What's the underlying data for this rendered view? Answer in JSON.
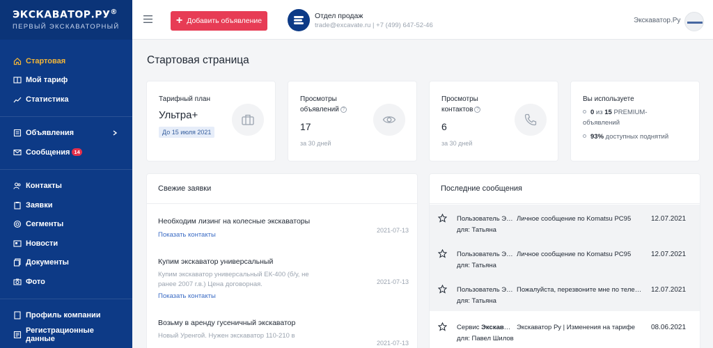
{
  "brand": {
    "logo_title": "ЭКСКАВАТОР.РУ",
    "logo_reg": "®",
    "logo_subtitle": "ПЕРВЫЙ ЭКСКАВАТОРНЫЙ",
    "accent": "#0d3a86",
    "active_color": "#f3b638",
    "button_color": "#e73c55"
  },
  "sidebar": {
    "group1": [
      {
        "label": "Стартовая",
        "icon": "home-icon",
        "active": true
      },
      {
        "label": "Мой тариф",
        "icon": "tariff-icon"
      },
      {
        "label": "Статистика",
        "icon": "chart-line-icon"
      }
    ],
    "group2": [
      {
        "label": "Объявления",
        "icon": "listings-icon",
        "chevron": true
      },
      {
        "label": "Сообщения",
        "icon": "mail-icon",
        "badge": "14"
      }
    ],
    "group3": [
      {
        "label": "Контакты",
        "icon": "users-icon"
      },
      {
        "label": "Заявки",
        "icon": "clipboard-icon"
      },
      {
        "label": "Сегменты",
        "icon": "target-icon"
      },
      {
        "label": "Новости",
        "icon": "news-icon"
      },
      {
        "label": "Документы",
        "icon": "documents-icon"
      },
      {
        "label": "Фото",
        "icon": "photo-icon"
      }
    ],
    "group4": [
      {
        "label": "Профиль компании",
        "icon": "building-icon"
      },
      {
        "label": "Регистрационные данные",
        "icon": "registration-icon"
      }
    ]
  },
  "header": {
    "add_button": "Добавить объявление",
    "sales_title": "Отдел продаж",
    "sales_contact": "trade@excavate.ru | +7 (499) 647-52-46",
    "user_name": "Экскаватор.Ру"
  },
  "main": {
    "page_title": "Стартовая страница",
    "cards": {
      "tariff": {
        "label": "Тарифный план",
        "value": "Ультра+",
        "badge": "До 15 июля 2021"
      },
      "views": {
        "label_l1": "Просмотры",
        "label_l2": "объявлений",
        "value": "17",
        "sub": "за 30 дней"
      },
      "contacts": {
        "label_l1": "Просмотры",
        "label_l2": "контактов",
        "value": "6",
        "sub": "за 30 дней"
      },
      "usage": {
        "label": "Вы используете",
        "l1_pre": "0",
        "l1_mid": " из ",
        "l1_num": "15",
        "l1_post": " PREMIUM-",
        "l1_line2": "объявлений",
        "l2_num": "93%",
        "l2_post": " доступных поднятий"
      }
    },
    "requests": {
      "title": "Свежие заявки",
      "link_label": "Показать контакты",
      "items": [
        {
          "title": "Необходим лизинг на колесные экскаваторы",
          "desc": "",
          "date": "2021-07-13"
        },
        {
          "title": "Купим экскаватор универсальный",
          "desc": "Купим экскаватор универсальный ЕК-400 (б/у, не ранее 2007 г.в.) Цена договорная.",
          "date": "2021-07-13"
        },
        {
          "title": "Возьму в аренду гусеничный экскаватор",
          "desc": "Новый Уренгой. Нужен экскаватор 110-210 в",
          "date": "2021-07-13"
        }
      ]
    },
    "messages": {
      "title": "Последние сообщения",
      "items": [
        {
          "from_l1": "Пользователь Экскаватор.Ру",
          "from_l2": "для: Татьяна",
          "subject": "Личное сообщение по Komatsu PC95",
          "date": "12.07.2021"
        },
        {
          "from_l1": "Пользователь Экскаватор.Ру",
          "from_l2": "для: Татьяна",
          "subject": "Личное сообщение по Komatsu PC95",
          "date": "12.07.2021"
        },
        {
          "from_l1": "Пользователь Экскаватор.Ру",
          "from_l2": "для: Татьяна",
          "subject": "Пожалуйста, перезвоните мне по телефону",
          "date": "12.07.2021"
        },
        {
          "from_pre": "Сервис ",
          "from_bold": "Экскаватор.Ру",
          "from_l2": "для: Павел Шилов",
          "subject": "Экскаватор Ру | Изменения на тарифе",
          "date": "08.06.2021"
        }
      ]
    }
  }
}
